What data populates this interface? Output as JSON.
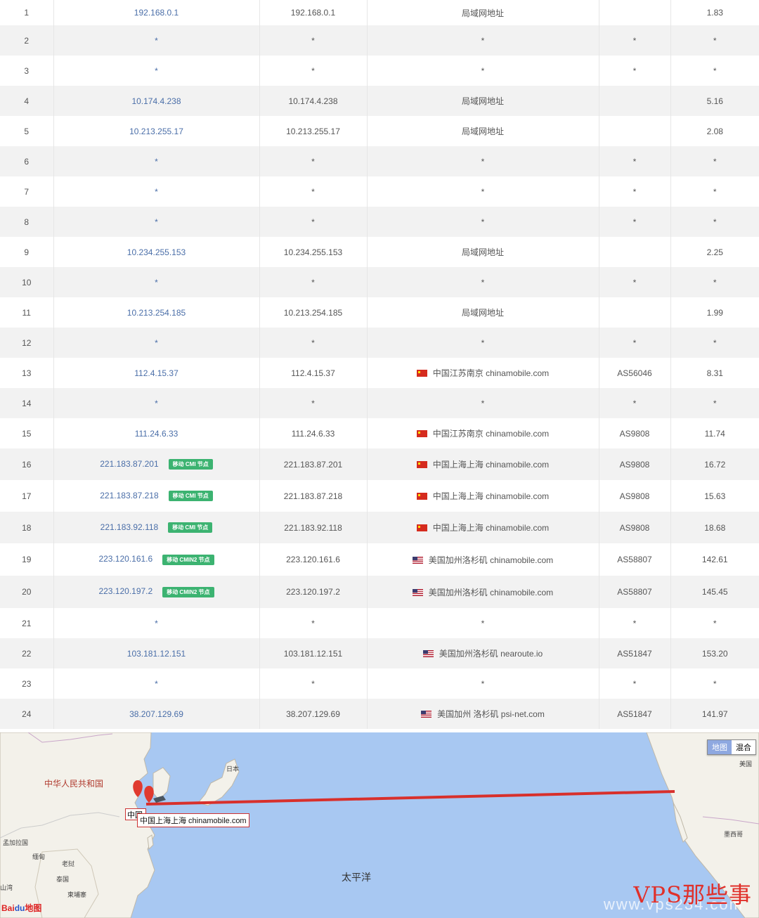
{
  "hops": [
    {
      "hop": "1",
      "ip": "192.168.0.1",
      "host": "192.168.0.1",
      "flag": "",
      "location": "局域网地址",
      "as": "",
      "time": "1.83",
      "badge": ""
    },
    {
      "hop": "2",
      "ip": "*",
      "host": "*",
      "flag": "",
      "location": "*",
      "as": "*",
      "time": "*",
      "badge": ""
    },
    {
      "hop": "3",
      "ip": "*",
      "host": "*",
      "flag": "",
      "location": "*",
      "as": "*",
      "time": "*",
      "badge": ""
    },
    {
      "hop": "4",
      "ip": "10.174.4.238",
      "host": "10.174.4.238",
      "flag": "",
      "location": "局域网地址",
      "as": "",
      "time": "5.16",
      "badge": ""
    },
    {
      "hop": "5",
      "ip": "10.213.255.17",
      "host": "10.213.255.17",
      "flag": "",
      "location": "局域网地址",
      "as": "",
      "time": "2.08",
      "badge": ""
    },
    {
      "hop": "6",
      "ip": "*",
      "host": "*",
      "flag": "",
      "location": "*",
      "as": "*",
      "time": "*",
      "badge": ""
    },
    {
      "hop": "7",
      "ip": "*",
      "host": "*",
      "flag": "",
      "location": "*",
      "as": "*",
      "time": "*",
      "badge": ""
    },
    {
      "hop": "8",
      "ip": "*",
      "host": "*",
      "flag": "",
      "location": "*",
      "as": "*",
      "time": "*",
      "badge": ""
    },
    {
      "hop": "9",
      "ip": "10.234.255.153",
      "host": "10.234.255.153",
      "flag": "",
      "location": "局域网地址",
      "as": "",
      "time": "2.25",
      "badge": ""
    },
    {
      "hop": "10",
      "ip": "*",
      "host": "*",
      "flag": "",
      "location": "*",
      "as": "*",
      "time": "*",
      "badge": ""
    },
    {
      "hop": "11",
      "ip": "10.213.254.185",
      "host": "10.213.254.185",
      "flag": "",
      "location": "局域网地址",
      "as": "",
      "time": "1.99",
      "badge": ""
    },
    {
      "hop": "12",
      "ip": "*",
      "host": "*",
      "flag": "",
      "location": "*",
      "as": "*",
      "time": "*",
      "badge": ""
    },
    {
      "hop": "13",
      "ip": "112.4.15.37",
      "host": "112.4.15.37",
      "flag": "cn",
      "location": "中国江苏南京 chinamobile.com",
      "as": "AS56046",
      "time": "8.31",
      "badge": ""
    },
    {
      "hop": "14",
      "ip": "*",
      "host": "*",
      "flag": "",
      "location": "*",
      "as": "*",
      "time": "*",
      "badge": ""
    },
    {
      "hop": "15",
      "ip": "111.24.6.33",
      "host": "111.24.6.33",
      "flag": "cn",
      "location": "中国江苏南京 chinamobile.com",
      "as": "AS9808",
      "time": "11.74",
      "badge": ""
    },
    {
      "hop": "16",
      "ip": "221.183.87.201",
      "host": "221.183.87.201",
      "flag": "cn",
      "location": "中国上海上海 chinamobile.com",
      "as": "AS9808",
      "time": "16.72",
      "badge": "移动 CMI 节点"
    },
    {
      "hop": "17",
      "ip": "221.183.87.218",
      "host": "221.183.87.218",
      "flag": "cn",
      "location": "中国上海上海 chinamobile.com",
      "as": "AS9808",
      "time": "15.63",
      "badge": "移动 CMI 节点"
    },
    {
      "hop": "18",
      "ip": "221.183.92.118",
      "host": "221.183.92.118",
      "flag": "cn",
      "location": "中国上海上海 chinamobile.com",
      "as": "AS9808",
      "time": "18.68",
      "badge": "移动 CMI 节点"
    },
    {
      "hop": "19",
      "ip": "223.120.161.6",
      "host": "223.120.161.6",
      "flag": "us",
      "location": "美国加州洛杉矶 chinamobile.com",
      "as": "AS58807",
      "time": "142.61",
      "badge": "移动 CMIN2 节点"
    },
    {
      "hop": "20",
      "ip": "223.120.197.2",
      "host": "223.120.197.2",
      "flag": "us",
      "location": "美国加州洛杉矶 chinamobile.com",
      "as": "AS58807",
      "time": "145.45",
      "badge": "移动 CMIN2 节点"
    },
    {
      "hop": "21",
      "ip": "*",
      "host": "*",
      "flag": "",
      "location": "*",
      "as": "*",
      "time": "*",
      "badge": ""
    },
    {
      "hop": "22",
      "ip": "103.181.12.151",
      "host": "103.181.12.151",
      "flag": "us",
      "location": "美国加州洛杉矶 nearoute.io",
      "as": "AS51847",
      "time": "153.20",
      "badge": ""
    },
    {
      "hop": "23",
      "ip": "*",
      "host": "*",
      "flag": "",
      "location": "*",
      "as": "*",
      "time": "*",
      "badge": ""
    },
    {
      "hop": "24",
      "ip": "38.207.129.69",
      "host": "38.207.129.69",
      "flag": "us",
      "location": "美国加州 洛杉矶 psi-net.com",
      "as": "AS51847",
      "time": "141.97",
      "badge": ""
    }
  ],
  "map": {
    "label_china": "中华人民共和国",
    "label_japan": "日本",
    "label_pacific": "太平洋",
    "label_usa": "美国",
    "label_mexico": "墨西哥",
    "label_bangladesh": "孟加拉国",
    "label_myanmar": "缅甸",
    "label_laos": "老挝",
    "label_thailand": "泰国",
    "label_cambodia": "柬埔寨",
    "label_bay": "山湾",
    "type_map": "地图",
    "type_hybrid": "混合",
    "tooltip_back": "中国",
    "tooltip": "中国上海上海 chinamobile.com",
    "baidu_logo": "Bai",
    "baidu_logo_du": "du",
    "baidu_logo_text": "地图",
    "route_color": "#d8302c",
    "marker_color": "#e03a2f"
  },
  "watermark": {
    "text": "VPS那些事",
    "url": "www.vps234.com"
  }
}
